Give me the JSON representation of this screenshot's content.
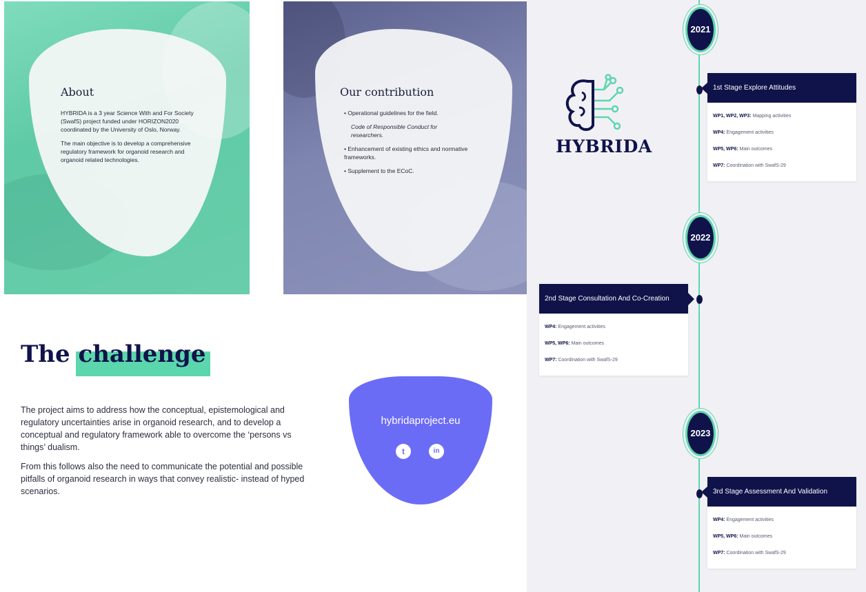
{
  "about": {
    "title": "About",
    "paragraphs": [
      "HYBRIDA is a 3 year Science With and For Society (SwafS) project funded under HORIZON2020 coordinated by the University of Oslo, Norway.",
      "The main objective is to develop a comprehensive regulatory framework for organoid research and organoid related technologies."
    ]
  },
  "contribution": {
    "title": "Our contribution",
    "items": [
      "• Operational guidelines for the field.",
      "Code of Responsible Conduct for researchers.",
      "• Enhancement of existing ethics and normative frameworks.",
      "• Supplement to the ECoC."
    ]
  },
  "challenge": {
    "title_plain": "The",
    "title_highlight": "challenge",
    "paragraphs": [
      "The project aims to address how the conceptual, epistemological and regulatory uncertainties arise in organoid research, and to develop a conceptual and regulatory framework able to overcome the ‘persons vs things’ dualism.",
      "From this follows also the need to communicate the potential and possible pitfalls of organoid research in ways that convey realistic- instead of hyped scenarios."
    ]
  },
  "shape": {
    "url": "hybridaproject.eu",
    "social_icons": [
      "twitter-icon",
      "linkedin-icon"
    ],
    "twitter_glyph": "t",
    "linkedin_glyph": "in"
  },
  "timeline": {
    "logo_text": "HYBRIDA",
    "years": [
      "2021",
      "2022",
      "2023"
    ],
    "stages": [
      {
        "title": "1st Stage Explore Attitudes",
        "rows": [
          {
            "bold": "WP1, WP2, WP3:",
            "text": " Mapping activities"
          },
          {
            "bold": "WP4:",
            "text": " Engagement activities"
          },
          {
            "bold": "WP5, WP6:",
            "text": " Main outcomes"
          },
          {
            "bold": "WP7:",
            "text": " Coordination with SwafS-29"
          }
        ]
      },
      {
        "title": "2nd Stage Consultation And Co-Creation",
        "rows": [
          {
            "bold": "WP4:",
            "text": " Engagement activities"
          },
          {
            "bold": "WP5, WP6:",
            "text": " Main outcomes"
          },
          {
            "bold": "WP7:",
            "text": " Coordination with SwafS-29"
          }
        ]
      },
      {
        "title": "3rd Stage Assessment And Validation",
        "rows": [
          {
            "bold": "WP4:",
            "text": " Engagement activities"
          },
          {
            "bold": "WP5, WP6:",
            "text": " Main outcomes"
          },
          {
            "bold": "WP7:",
            "text": " Coordination with SwafS-29"
          }
        ]
      }
    ]
  },
  "colors": {
    "navy": "#10134a",
    "mint": "#5cd6ad",
    "purple": "#6b6cf6"
  }
}
